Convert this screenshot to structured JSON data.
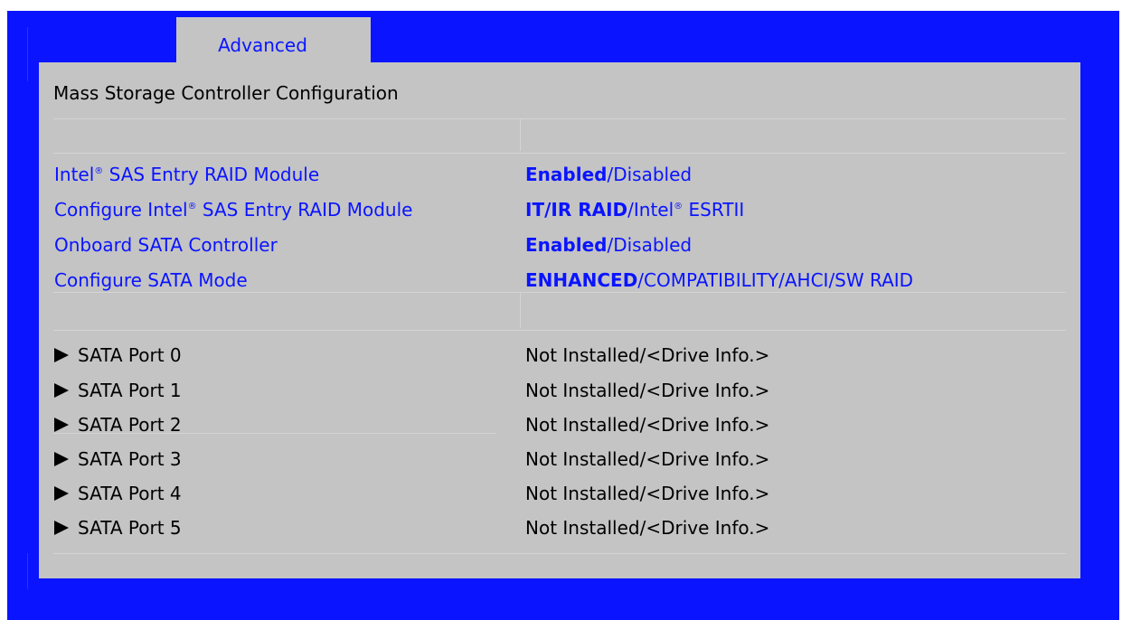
{
  "tabs": {
    "active_label": "Advanced"
  },
  "panel": {
    "title": "Mass Storage Controller Configuration"
  },
  "settings": [
    {
      "label_pre": "Intel",
      "label_reg": "®",
      "label_post": " SAS Entry RAID Module",
      "value_selected": "Enabled",
      "value_rest": "/Disabled",
      "value_reg": "",
      "value_tail": ""
    },
    {
      "label_pre": "Configure Intel",
      "label_reg": "®",
      "label_post": " SAS Entry RAID Module",
      "value_selected": "IT/IR RAID",
      "value_rest": "/Intel",
      "value_reg": "®",
      "value_tail": " ESRTII"
    },
    {
      "label_pre": "Onboard SATA Controller",
      "label_reg": "",
      "label_post": "",
      "value_selected": "Enabled",
      "value_rest": "/Disabled",
      "value_reg": "",
      "value_tail": ""
    },
    {
      "label_pre": "Configure SATA Mode",
      "label_reg": "",
      "label_post": "",
      "value_selected": "ENHANCED",
      "value_rest": "/COMPATIBILITY/AHCI/SW RAID",
      "value_reg": "",
      "value_tail": ""
    }
  ],
  "ports": [
    {
      "label": "SATA Port 0",
      "value": "Not Installed/<Drive Info.>"
    },
    {
      "label": "SATA Port 1",
      "value": "Not Installed/<Drive Info.>"
    },
    {
      "label": "SATA Port 2",
      "value": "Not Installed/<Drive Info.>"
    },
    {
      "label": "SATA Port 3",
      "value": "Not Installed/<Drive Info.>"
    },
    {
      "label": "SATA Port 4",
      "value": "Not Installed/<Drive Info.>"
    },
    {
      "label": "SATA Port 5",
      "value": "Not Installed/<Drive Info.>"
    }
  ],
  "colors": {
    "frame": "#0a14ff",
    "panel": "#c4c4c4",
    "link": "#0a14ff",
    "text": "#000000"
  },
  "icons": {
    "submenu": "triangle-right-icon"
  }
}
